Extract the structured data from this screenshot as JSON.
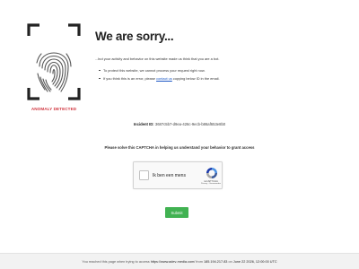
{
  "anomaly": {
    "label": "ANOMALY DETECTED",
    "label_color": "#d0343e",
    "icon": "fingerprint-icon"
  },
  "main": {
    "title": "We are sorry...",
    "intro": "...but your activity and behavior on this website made us think that you are a bot.",
    "bullet_1": "To protect this website, we cannot process your request right now.",
    "bullet_2_before": "If you think this is an error, please",
    "bullet_2_link": "contact us",
    "bullet_2_after": "copying below ID in the email."
  },
  "incident": {
    "label": "Incident ID:",
    "value": "3687c5b7-d9ea-426c-9ecb-b86af653e8b0"
  },
  "captcha": {
    "prompt": "Please solve this CAPTCHA in helping us understand your behavior to grant access",
    "checkbox_label": "Ik ben een mens",
    "brand": "reCAPTCHA",
    "privacy_terms": "Privacy - Voorwaarden"
  },
  "actions": {
    "submit_label": "Submit",
    "submit_color": "#41b252"
  },
  "footer": {
    "prefix": "You reached this page when trying to access",
    "url": "https://www.adev-media.com/",
    "from_label": "from",
    "ip": "185.194.217.83",
    "on_label": "on",
    "datetime": "June 22 2026, 12:00:00 UTC"
  },
  "colors": {
    "link": "#1a56c4",
    "text": "#222222",
    "footer_bg": "#f2f2f2"
  }
}
